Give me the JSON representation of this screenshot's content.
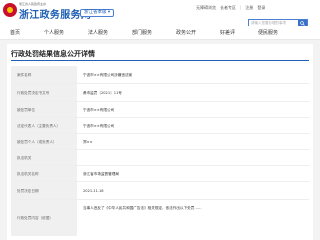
{
  "header": {
    "logo_small": "浙江省人民政府主办",
    "logo_title": "浙江政务服务网",
    "region": "浙江省本级 ▾",
    "top_links": [
      "无障碍浏览",
      "长者专区",
      "注册",
      "登录"
    ],
    "search_placeholder": "请输入您要办理的事项"
  },
  "nav": [
    "首页",
    "个人服务",
    "法人服务",
    "部门服务",
    "政务公开",
    "好差评",
    "便民服务"
  ],
  "card": {
    "title": "行政处罚结果信息公开详情",
    "rows": [
      {
        "label": "案件名称",
        "value": "宁波市××有限公司涉嫌违法案"
      },
      {
        "label": "行政处罚决定书文号",
        "value": "甬市监罚〔2021〕11号"
      },
      {
        "label": "被处罚单位",
        "value": "宁波市××有限公司"
      },
      {
        "label": "法定代表人（主要负责人）",
        "value": "宁波市××有限公司"
      },
      {
        "label": "被处罚个人（或负责人）",
        "value": "郑××"
      },
      {
        "label": "执法机关",
        "value": ""
      },
      {
        "label": "执法机关名称",
        "value": "浙江省市场监督管理局"
      },
      {
        "label": "处罚决定日期",
        "value": "2021.11.16"
      },
      {
        "label": "行政处罚内容（依据）",
        "value": "当事人违反了《中华人民共和国广告法》相关规定，依法作出以下处罚……"
      }
    ]
  }
}
